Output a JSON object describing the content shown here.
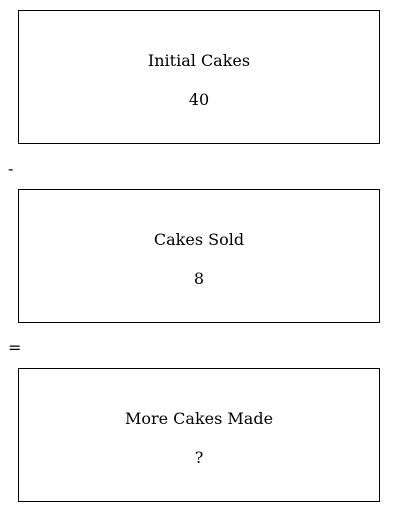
{
  "boxes": [
    {
      "label": "Initial Cakes",
      "value": "40"
    },
    {
      "label": "Cakes Sold",
      "value": "8"
    },
    {
      "label": "More Cakes Made",
      "value": "?"
    }
  ],
  "operators": [
    "-",
    "="
  ]
}
